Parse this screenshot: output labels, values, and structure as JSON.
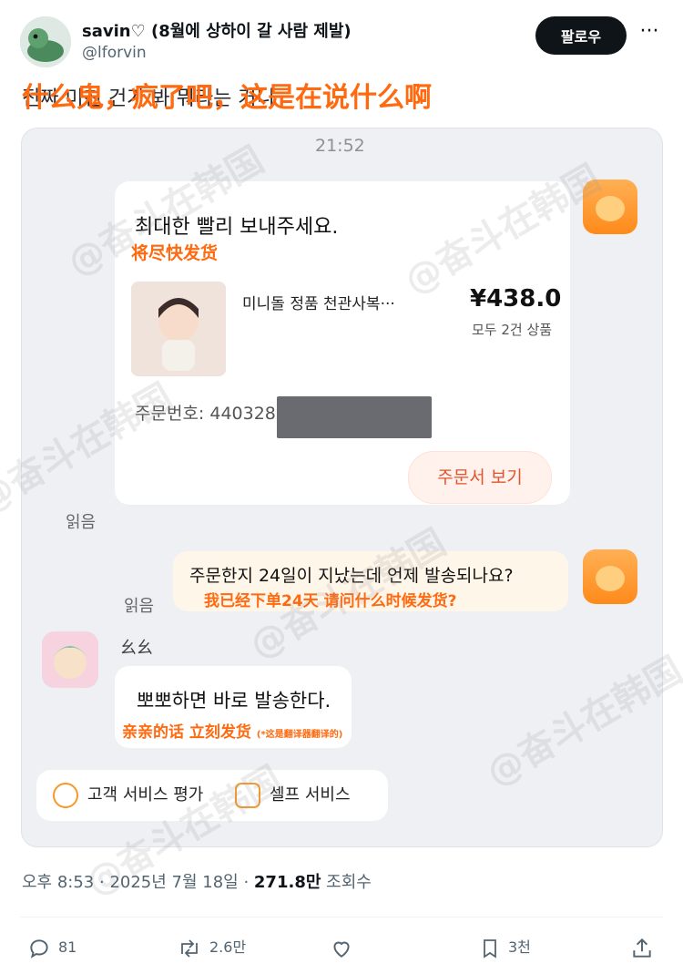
{
  "post": {
    "display_name": "savin♡ (8월에 상하이 갈 사람 제발)",
    "handle": "@lforvin",
    "follow_label": "팔로우",
    "more_label": "···",
    "text_korean": "진짜 미친 건가 봐 뭐라는 거니",
    "caption_overlay": "什么鬼，疯了吧，这是在说什么啊"
  },
  "screenshot": {
    "time": "21:52",
    "order": {
      "title": "최대한 빨리 보내주세요.",
      "title_translation": "将尽快发货",
      "product_name": "미니돌 정품 천관사복···",
      "price": "¥438.0",
      "quantity": "모두 2건 상품",
      "order_number": "주문번호: 440328",
      "view_button": "주문서 보기"
    },
    "read_label": "읽음",
    "user_message": {
      "text": "주문한지 24일이 지났는데 언제 발송되나요?",
      "translation": "我已经下单24天 请问什么时候发货?"
    },
    "seller": {
      "name": "幺幺",
      "reply": "뽀뽀하면 바로 발송한다.",
      "reply_translation": "亲亲的话 立刻发货",
      "translation_note": "(*这是翻译器翻译的)"
    },
    "service_bar": {
      "rating": "고객 서비스 평가",
      "self_service": "셀프 서비스"
    }
  },
  "meta": {
    "time": "오후 8:53",
    "date": "2025년 7월 18일",
    "views": "271.8만",
    "views_label": "조회수"
  },
  "actions": {
    "replies": "81",
    "reposts": "2.6만",
    "bookmarks": "3천"
  },
  "watermark": "@奋斗在韩国",
  "colors": {
    "accent": "#ff6a10",
    "text": "#0f1419",
    "muted": "#536471"
  }
}
